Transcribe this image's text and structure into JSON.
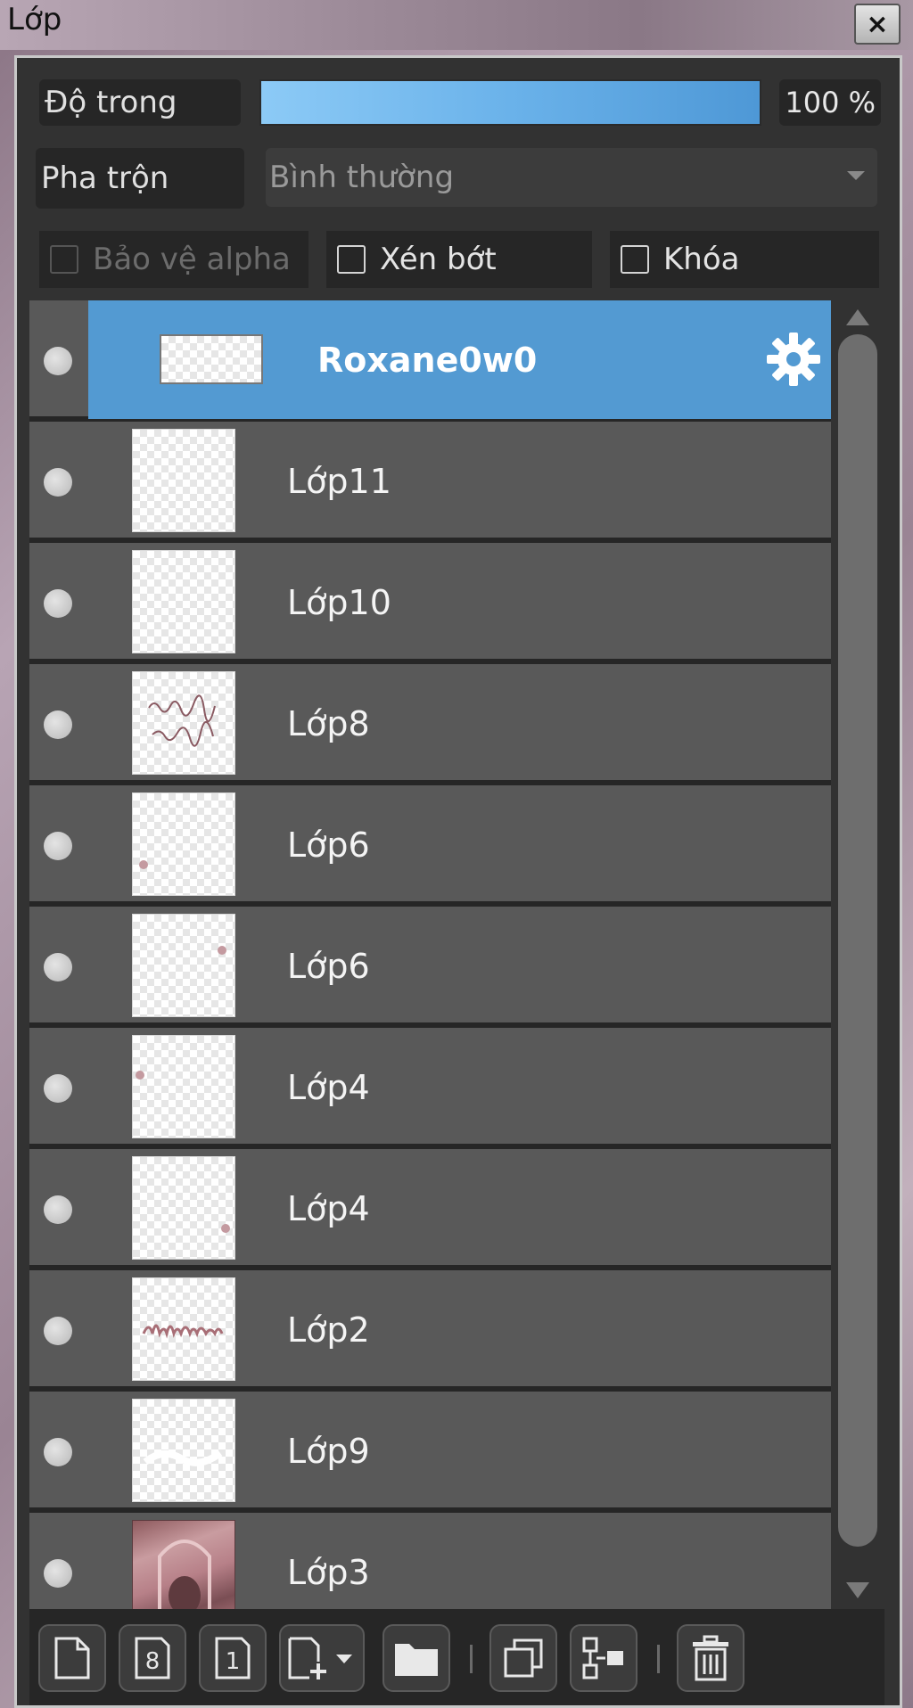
{
  "window": {
    "title": "Lớp",
    "close_label": "×"
  },
  "controls": {
    "opacity_label": "Độ trong",
    "opacity_value": 100,
    "opacity_text": "100 %",
    "blend_label": "Pha trộn",
    "blend_value": "Bình thường",
    "protect_alpha_label": "Bảo vệ alpha",
    "clip_label": "Xén bớt",
    "lock_label": "Khóa"
  },
  "layers": [
    {
      "name": "Roxane0w0",
      "selected": true,
      "visible": true,
      "thumbnail": "banner"
    },
    {
      "name": "Lớp11",
      "selected": false,
      "visible": true,
      "thumbnail": "empty"
    },
    {
      "name": "Lớp10",
      "selected": false,
      "visible": true,
      "thumbnail": "empty"
    },
    {
      "name": "Lớp8",
      "selected": false,
      "visible": true,
      "thumbnail": "scribble"
    },
    {
      "name": "Lớp6",
      "selected": false,
      "visible": true,
      "thumbnail": "mark-left"
    },
    {
      "name": "Lớp6",
      "selected": false,
      "visible": true,
      "thumbnail": "mark-right"
    },
    {
      "name": "Lớp4",
      "selected": false,
      "visible": true,
      "thumbnail": "mark-topleft"
    },
    {
      "name": "Lớp4",
      "selected": false,
      "visible": true,
      "thumbnail": "mark-right-low"
    },
    {
      "name": "Lớp2",
      "selected": false,
      "visible": true,
      "thumbnail": "handwriting"
    },
    {
      "name": "Lớp9",
      "selected": false,
      "visible": true,
      "thumbnail": "white-strokes"
    },
    {
      "name": "Lớp3",
      "selected": false,
      "visible": true,
      "thumbnail": "photo"
    }
  ],
  "toolbar": {
    "buttons": [
      {
        "icon": "new-page-icon",
        "label": ""
      },
      {
        "icon": "new-layer-8bit-icon",
        "label": "8"
      },
      {
        "icon": "new-layer-1bit-icon",
        "label": "1"
      },
      {
        "icon": "add-layer-dropdown-icon",
        "label": ""
      },
      {
        "icon": "folder-icon",
        "label": ""
      },
      {
        "icon": "duplicate-layer-icon",
        "label": ""
      },
      {
        "icon": "merge-layer-icon",
        "label": ""
      },
      {
        "icon": "trash-icon",
        "label": ""
      }
    ]
  },
  "colors": {
    "panel_bg": "#323232",
    "row_bg": "#595959",
    "selected_row": "#539ad2",
    "opacity_fill": "#6ab2ea"
  }
}
